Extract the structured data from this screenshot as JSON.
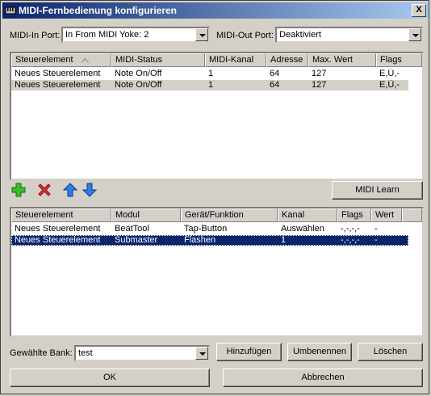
{
  "window": {
    "title": "MIDI-Fernbedienung konfigurieren",
    "close_label": "X"
  },
  "ports": {
    "in_label": "MIDI-In Port:",
    "in_value": "In From MIDI Yoke:  2",
    "out_label": "MIDI-Out Port:",
    "out_value": "Deaktiviert"
  },
  "top_table": {
    "columns": [
      "Steuerelement",
      "MIDI-Status",
      "MIDI-Kanal",
      "Adresse",
      "Max. Wert",
      "Flags"
    ],
    "rows": [
      [
        "Neues Steuerelement",
        "Note On/Off",
        "1",
        "64",
        "127",
        "E,Ü,-"
      ],
      [
        "Neues Steuerelement",
        "Note On/Off",
        "1",
        "64",
        "127",
        "E,Ü,-"
      ]
    ]
  },
  "toolbar": {
    "add_icon": "plus-icon",
    "delete_icon": "red-x-icon",
    "up_icon": "arrow-up-icon",
    "down_icon": "arrow-down-icon",
    "midi_learn_label": "MIDI Learn"
  },
  "bottom_table": {
    "columns": [
      "Steuerelement",
      "Modul",
      "Gerät/Funktion",
      "Kanal",
      "Flags",
      "Wert"
    ],
    "rows": [
      [
        "Neues Steuerelement",
        "BeatTool",
        "Tap-Button",
        "Auswählen",
        "-,-,-,-",
        "-"
      ],
      [
        "Neues Steuerelement",
        "Submaster",
        "Flashen",
        "1",
        "-,-,-,-",
        "-"
      ]
    ]
  },
  "bank": {
    "label": "Gewählte Bank:",
    "value": "test",
    "add_label": "Hinzufügen",
    "rename_label": "Umbenennen",
    "delete_label": "Löschen"
  },
  "footer": {
    "ok_label": "OK",
    "cancel_label": "Abbrechen"
  },
  "colors": {
    "title_start": "#0a246a",
    "title_end": "#a6caf0",
    "selection": "#0a246a",
    "face": "#d4d0c8"
  }
}
